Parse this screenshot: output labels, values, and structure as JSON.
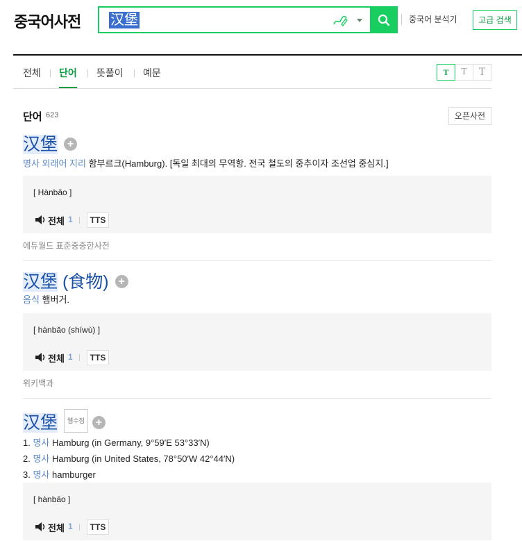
{
  "header": {
    "logo": "중국어사전",
    "search_value": "汉堡",
    "analyzer_label": "중국어 분석기",
    "advanced_label": "고급 검색"
  },
  "tabs": [
    {
      "label": "전체",
      "active": false
    },
    {
      "label": "단어",
      "active": true
    },
    {
      "label": "뜻풀이",
      "active": false
    },
    {
      "label": "예문",
      "active": false
    }
  ],
  "font_sizes": [
    "T",
    "T",
    "T"
  ],
  "section": {
    "title": "단어",
    "count": "623",
    "open_dict_label": "오픈사전"
  },
  "audio": {
    "all_label": "전체",
    "all_count": "1",
    "tts_label": "TTS"
  },
  "entries": [
    {
      "word": "汉堡",
      "suffix": "",
      "badge": "",
      "meanings": [
        {
          "num": "",
          "pos": "명사 외래어 지리",
          "text": "함부르크(Hamburg). [독일 최대의 무역항. 전국 철도의 중추이자 조선업 중심지.]"
        }
      ],
      "pron": "[ Hànbǎo ]",
      "source": "에듀월드 표준중중한사전"
    },
    {
      "word": "汉堡",
      "suffix": " (食物)",
      "badge": "",
      "meanings": [
        {
          "num": "",
          "pos": "음식",
          "text": "햄버거."
        }
      ],
      "pron": "[ hànbǎo (shíwù) ]",
      "source": "위키백과"
    },
    {
      "word": "汉堡",
      "suffix": "",
      "badge": "웹수집",
      "meanings": [
        {
          "num": "1.",
          "pos": "명사",
          "text": "Hamburg (in Germany, 9°59′E 53°33′N)"
        },
        {
          "num": "2.",
          "pos": "명사",
          "text": "Hamburg (in United States, 78°50′W 42°44′N)"
        },
        {
          "num": "3.",
          "pos": "명사",
          "text": "hamburger"
        }
      ],
      "pron": "[ hànbǎo ]",
      "source": ""
    }
  ]
}
